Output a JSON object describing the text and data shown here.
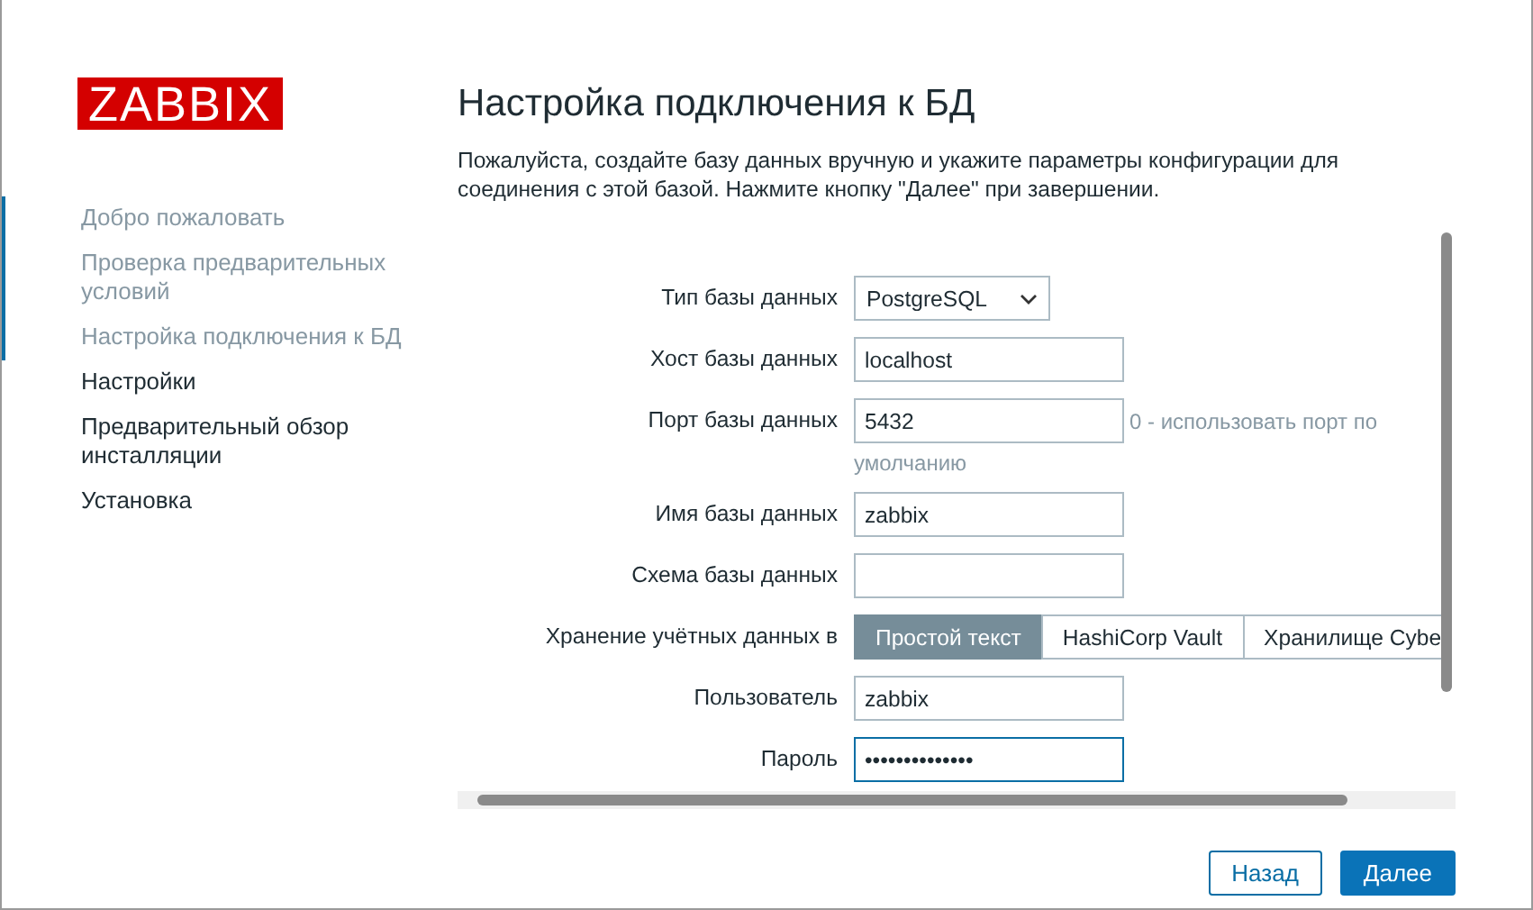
{
  "logo": {
    "text": "ZABBIX"
  },
  "steps": [
    {
      "label": "Добро пожаловать",
      "done": true
    },
    {
      "label": "Проверка предварительных условий",
      "done": true
    },
    {
      "label": "Настройка подключения к БД",
      "done": true
    },
    {
      "label": "Настройки",
      "done": false
    },
    {
      "label": "Предварительный обзор инсталляции",
      "done": false
    },
    {
      "label": "Установка",
      "done": false
    }
  ],
  "title": "Настройка подключения к БД",
  "description": "Пожалуйста, создайте базу данных вручную и укажите параметры конфигурации для соединения с этой базой. Нажмите кнопку \"Далее\" при завершении.",
  "fields": [
    {
      "kind": "select",
      "label": "Тип базы данных",
      "value": "PostgreSQL"
    },
    {
      "kind": "text",
      "label": "Хост базы данных",
      "value": "localhost",
      "focused": false
    },
    {
      "kind": "text",
      "label": "Порт базы данных",
      "value": "5432",
      "hint": "0 - использовать порт по умолчанию",
      "focused": false
    },
    {
      "kind": "text",
      "label": "Имя базы данных",
      "value": "zabbix",
      "focused": false
    },
    {
      "kind": "text",
      "label": "Схема базы данных",
      "focused": false
    },
    {
      "kind": "segmented",
      "label": "Хранение учётных данных в",
      "options": [
        {
          "label": "Простой текст",
          "selected": true
        },
        {
          "label": "HashiCorp Vault",
          "selected": false
        },
        {
          "label": "Хранилище Cybe",
          "selected": false
        }
      ]
    },
    {
      "kind": "text",
      "label": "Пользователь",
      "value": "zabbix",
      "focused": false
    },
    {
      "kind": "text",
      "label": "Пароль",
      "value": "••••••••••••••",
      "focused": true
    }
  ],
  "buttons": [
    {
      "label": "Назад",
      "kind": "secondary"
    },
    {
      "label": "Далее",
      "kind": "primary"
    }
  ]
}
